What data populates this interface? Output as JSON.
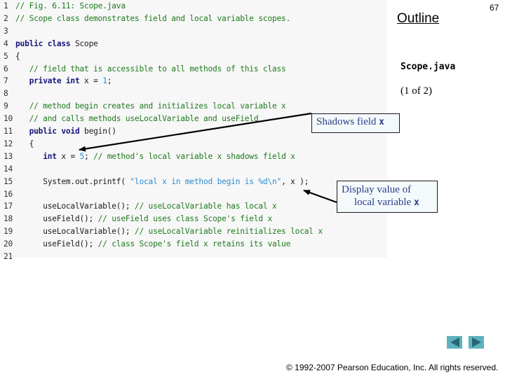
{
  "slide": {
    "page_number": "67",
    "outline_title": "Outline",
    "file_name": "Scope.java",
    "page_of": "(1 of  2)",
    "copyright": "© 1992-2007 Pearson Education, Inc.  All rights reserved."
  },
  "code": {
    "lines": [
      {
        "n": "1",
        "tokens": [
          {
            "t": "cm",
            "v": "// Fig. 6.11: Scope.java"
          }
        ]
      },
      {
        "n": "2",
        "tokens": [
          {
            "t": "cm",
            "v": "// Scope class demonstrates field and local variable scopes."
          }
        ]
      },
      {
        "n": "3",
        "tokens": []
      },
      {
        "n": "4",
        "tokens": [
          {
            "t": "kw",
            "v": "public class "
          },
          {
            "t": "plain",
            "v": "Scope"
          }
        ]
      },
      {
        "n": "5",
        "tokens": [
          {
            "t": "plain",
            "v": "{"
          }
        ]
      },
      {
        "n": "6",
        "tokens": [
          {
            "t": "plain",
            "v": "   "
          },
          {
            "t": "cm",
            "v": "// field that is accessible to all methods of this class"
          }
        ]
      },
      {
        "n": "7",
        "tokens": [
          {
            "t": "plain",
            "v": "   "
          },
          {
            "t": "kw",
            "v": "private int "
          },
          {
            "t": "plain",
            "v": "x = "
          },
          {
            "t": "num",
            "v": "1"
          },
          {
            "t": "plain",
            "v": ";"
          }
        ]
      },
      {
        "n": "8",
        "tokens": []
      },
      {
        "n": "9",
        "tokens": [
          {
            "t": "plain",
            "v": "   "
          },
          {
            "t": "cm",
            "v": "// method begin creates and initializes local variable x"
          }
        ]
      },
      {
        "n": "10",
        "tokens": [
          {
            "t": "plain",
            "v": "   "
          },
          {
            "t": "cm",
            "v": "// and calls methods useLocalVariable and useField"
          }
        ]
      },
      {
        "n": "11",
        "tokens": [
          {
            "t": "plain",
            "v": "   "
          },
          {
            "t": "kw",
            "v": "public void "
          },
          {
            "t": "plain",
            "v": "begin()"
          }
        ]
      },
      {
        "n": "12",
        "tokens": [
          {
            "t": "plain",
            "v": "   {"
          }
        ]
      },
      {
        "n": "13",
        "tokens": [
          {
            "t": "plain",
            "v": "      "
          },
          {
            "t": "kw",
            "v": "int "
          },
          {
            "t": "plain",
            "v": "x = "
          },
          {
            "t": "num",
            "v": "5"
          },
          {
            "t": "plain",
            "v": "; "
          },
          {
            "t": "cm",
            "v": "// method's local variable x shadows field x"
          }
        ]
      },
      {
        "n": "14",
        "tokens": []
      },
      {
        "n": "15",
        "tokens": [
          {
            "t": "plain",
            "v": "      System.out.printf( "
          },
          {
            "t": "str",
            "v": "\"local x in method begin is %d\\n\""
          },
          {
            "t": "plain",
            "v": ", x );"
          }
        ]
      },
      {
        "n": "16",
        "tokens": []
      },
      {
        "n": "17",
        "tokens": [
          {
            "t": "plain",
            "v": "      useLocalVariable(); "
          },
          {
            "t": "cm",
            "v": "// useLocalVariable has local x"
          }
        ]
      },
      {
        "n": "18",
        "tokens": [
          {
            "t": "plain",
            "v": "      useField(); "
          },
          {
            "t": "cm",
            "v": "// useField uses class Scope's field x"
          }
        ]
      },
      {
        "n": "19",
        "tokens": [
          {
            "t": "plain",
            "v": "      useLocalVariable(); "
          },
          {
            "t": "cm",
            "v": "// useLocalVariable reinitializes local x"
          }
        ]
      },
      {
        "n": "20",
        "tokens": [
          {
            "t": "plain",
            "v": "      useField(); "
          },
          {
            "t": "cm",
            "v": "// class Scope's field x retains its value"
          }
        ]
      },
      {
        "n": "21",
        "tokens": []
      }
    ]
  },
  "callouts": {
    "shadows": {
      "text": "Shadows field ",
      "code": "x"
    },
    "display": {
      "line1": "Display value of",
      "line2": "local variable ",
      "code": "x"
    }
  },
  "nav": {
    "prev_icon": "previous-slide-icon",
    "next_icon": "next-slide-icon"
  },
  "colors": {
    "code_background": "#f7f7f7",
    "keyword": "#16167a",
    "comment": "#1d7a1d",
    "string_literal": "#2a8ed0",
    "callout_text": "#2b3f86",
    "nav_button": "#5fb3c0"
  }
}
